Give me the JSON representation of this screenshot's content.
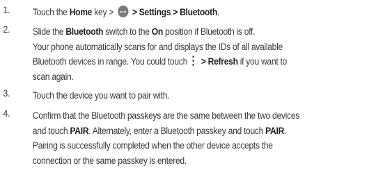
{
  "steps": [
    {
      "number": "1.",
      "part_touch": "Touch the ",
      "home_key": "Home",
      "part_key": " key > ",
      "icon": "apps-dots-icon",
      "part_sep": " > ",
      "settings_path": "Settings > Bluetooth",
      "part_end": "."
    },
    {
      "number": "2.",
      "part_slide": "Slide the ",
      "bluetooth": "Bluetooth",
      "part_switch": " switch to the ",
      "on": "On",
      "part_off": " position if Bluetooth is off.",
      "line2": "Your phone automatically scans for and displays the IDs of all available",
      "line3_part": "Bluetooth devices in range. You could touch",
      "icon": "vertical-menu-icon",
      "refresh": "> Refresh",
      "line3_end": " if you want to",
      "line4": "scan again."
    },
    {
      "number": "3.",
      "text": "Touch the device you want to pair with."
    },
    {
      "number": "4.",
      "line1": "Confirm that the Bluetooth passkeys are the same between the two devices",
      "line2_part": "and touch ",
      "pair": "PAIR",
      "line2_mid": ". Alternately, enter a Bluetooth passkey and touch ",
      "pair2": "PAIR",
      "line2_end": ".",
      "line3": "Pairing is successfully completed when the other device accepts the",
      "line4": "connection or the same passkey is entered."
    }
  ]
}
